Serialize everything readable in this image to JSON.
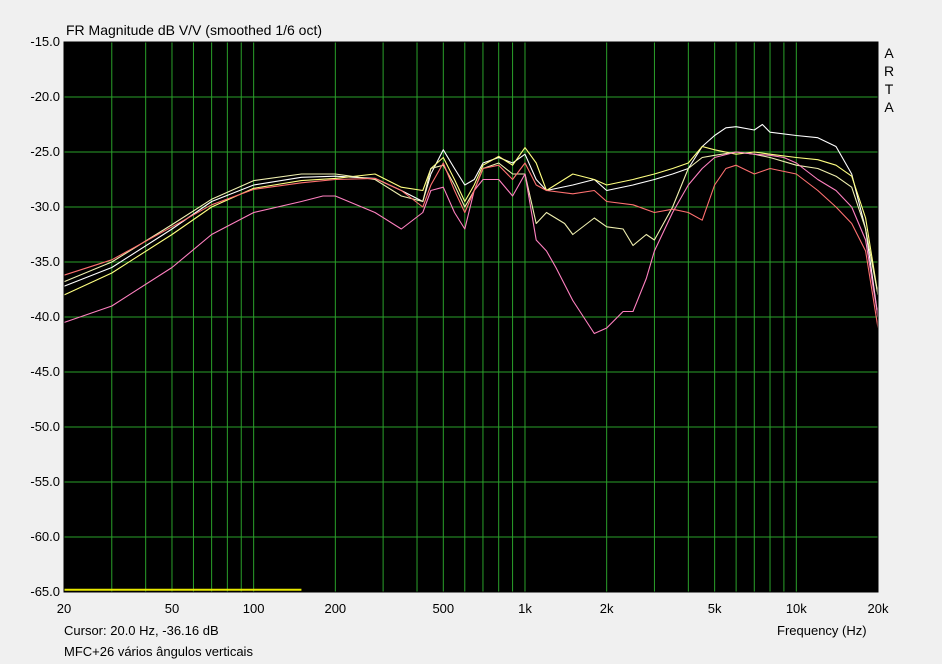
{
  "brand_letters": [
    "A",
    "R",
    "T",
    "A"
  ],
  "status": {
    "cursor": "Cursor: 20.0 Hz, -36.16 dB",
    "caption": "MFC+26 vários ângulos verticais"
  },
  "colors": {
    "plot_background": "#000000",
    "grid": "#2aa02a",
    "window_background": "#f0f0f0",
    "marker": "#e8e800"
  },
  "chart_data": {
    "type": "line",
    "title": "FR Magnitude dB V/V (smoothed 1/6 oct)",
    "xlabel": "Frequency (Hz)",
    "ylabel": "",
    "xscale": "log",
    "xlim": [
      20,
      20000
    ],
    "ylim": [
      -65,
      -15
    ],
    "grid": true,
    "yticks": [
      -15,
      -20,
      -25,
      -30,
      -35,
      -40,
      -45,
      -50,
      -55,
      -60,
      -65
    ],
    "ytick_labels": [
      "-15.0",
      "-20.0",
      "-25.0",
      "-30.0",
      "-35.0",
      "-40.0",
      "-45.0",
      "-50.0",
      "-55.0",
      "-60.0",
      "-65.0"
    ],
    "xticks": [
      20,
      50,
      100,
      200,
      500,
      1000,
      2000,
      5000,
      10000,
      20000
    ],
    "xtick_labels": [
      "20",
      "50",
      "100",
      "200",
      "500",
      "1k",
      "2k",
      "5k",
      "10k",
      "20k"
    ],
    "marker_segment": {
      "x": [
        20,
        150
      ],
      "y": -64.8,
      "color": "#e8e800"
    },
    "series": [
      {
        "color": "#ffffff",
        "x": [
          20,
          30,
          50,
          70,
          100,
          150,
          200,
          280,
          350,
          420,
          450,
          500,
          550,
          600,
          650,
          700,
          800,
          900,
          1000,
          1100,
          1200,
          1500,
          1800,
          2000,
          2500,
          3000,
          3500,
          4000,
          4500,
          5000,
          5500,
          6000,
          7000,
          7500,
          8000,
          10000,
          12000,
          14000,
          16000,
          18000,
          20000
        ],
        "y": [
          -37.2,
          -35.5,
          -32,
          -29.5,
          -28,
          -27.3,
          -27.2,
          -27.4,
          -28.5,
          -29.5,
          -27,
          -24.8,
          -26.5,
          -28,
          -27.5,
          -26,
          -25.5,
          -26,
          -25.2,
          -27.5,
          -28.5,
          -28,
          -27.5,
          -28.5,
          -28,
          -27.5,
          -27,
          -26.5,
          -24.5,
          -23.5,
          -22.8,
          -22.7,
          -23,
          -22.5,
          -23.2,
          -23.5,
          -23.7,
          -24.5,
          -27,
          -32,
          -40
        ]
      },
      {
        "color": "#ffff80",
        "x": [
          20,
          30,
          50,
          70,
          100,
          150,
          200,
          280,
          350,
          420,
          450,
          500,
          550,
          600,
          650,
          700,
          800,
          900,
          1000,
          1100,
          1200,
          1500,
          1800,
          2000,
          2500,
          3000,
          3500,
          4000,
          4500,
          5000,
          6000,
          7000,
          8000,
          10000,
          12000,
          14000,
          16000,
          18000,
          20000
        ],
        "y": [
          -38,
          -36,
          -32.5,
          -30,
          -28.3,
          -27.6,
          -27.4,
          -27,
          -28.2,
          -28.5,
          -26.5,
          -25.5,
          -27.5,
          -29.5,
          -28,
          -26.2,
          -25.4,
          -26.2,
          -24.6,
          -26,
          -28.5,
          -27,
          -27.5,
          -28,
          -27.5,
          -27,
          -26.5,
          -26,
          -24.5,
          -24.8,
          -25.2,
          -25,
          -25.2,
          -25.5,
          -25.7,
          -26.2,
          -27.2,
          -31,
          -38
        ]
      },
      {
        "color": "#f0f0b0",
        "x": [
          20,
          30,
          50,
          70,
          100,
          150,
          200,
          280,
          350,
          420,
          450,
          500,
          550,
          600,
          650,
          700,
          800,
          900,
          1000,
          1100,
          1200,
          1400,
          1500,
          1800,
          2000,
          2300,
          2500,
          2800,
          3000,
          3500,
          4000,
          4500,
          5000,
          6000,
          7000,
          8000,
          10000,
          12000,
          14000,
          16000,
          18000,
          20000
        ],
        "y": [
          -36.8,
          -35,
          -31.6,
          -29.3,
          -27.6,
          -27,
          -27,
          -27.5,
          -29,
          -29.5,
          -26.5,
          -26.2,
          -28,
          -30,
          -28.5,
          -26.5,
          -26,
          -27,
          -27,
          -31.5,
          -30.5,
          -31.5,
          -32.5,
          -31,
          -31.8,
          -32,
          -33.5,
          -32.5,
          -33,
          -30,
          -26.5,
          -25.5,
          -25.3,
          -25,
          -25.2,
          -25.5,
          -26.2,
          -26.5,
          -27.2,
          -28.2,
          -32,
          -38
        ]
      },
      {
        "color": "#ff80c0",
        "x": [
          20,
          30,
          50,
          70,
          100,
          150,
          180,
          200,
          280,
          350,
          420,
          450,
          500,
          550,
          600,
          650,
          700,
          800,
          900,
          1000,
          1100,
          1200,
          1300,
          1500,
          1800,
          2000,
          2300,
          2500,
          2800,
          3000,
          3500,
          4000,
          4500,
          5000,
          6000,
          7000,
          8000,
          9000,
          10000,
          12000,
          14000,
          16000,
          18000,
          20000
        ],
        "y": [
          -40.5,
          -39,
          -35.5,
          -32.5,
          -30.5,
          -29.5,
          -29,
          -29,
          -30.5,
          -32,
          -30.5,
          -28.5,
          -28.2,
          -30.5,
          -32,
          -28.5,
          -27.5,
          -27.5,
          -29,
          -27,
          -33,
          -34,
          -35.5,
          -38.5,
          -41.5,
          -41,
          -39.5,
          -39.5,
          -36.5,
          -34,
          -30.5,
          -28,
          -26.5,
          -25.5,
          -25,
          -25.2,
          -25.3,
          -25.5,
          -26,
          -27.5,
          -28.5,
          -30,
          -33,
          -40
        ]
      },
      {
        "color": "#ff7070",
        "x": [
          20,
          30,
          50,
          70,
          100,
          150,
          200,
          280,
          350,
          420,
          450,
          500,
          550,
          600,
          650,
          700,
          800,
          900,
          1000,
          1100,
          1200,
          1500,
          1800,
          2000,
          2500,
          3000,
          3500,
          4000,
          4500,
          5000,
          5500,
          6000,
          7000,
          8000,
          10000,
          12000,
          14000,
          16000,
          18000,
          20000
        ],
        "y": [
          -36.2,
          -34.8,
          -31.8,
          -29.8,
          -28.4,
          -27.8,
          -27.5,
          -27.4,
          -28.5,
          -30,
          -28,
          -26,
          -28.5,
          -30.5,
          -28.5,
          -26.5,
          -26.2,
          -27.5,
          -26,
          -28,
          -28.5,
          -28.8,
          -28.5,
          -29.5,
          -29.8,
          -30.5,
          -30.2,
          -30.5,
          -31.2,
          -28,
          -26.5,
          -26.2,
          -27,
          -26.5,
          -27,
          -28.5,
          -30,
          -31.5,
          -34,
          -41
        ]
      }
    ]
  }
}
